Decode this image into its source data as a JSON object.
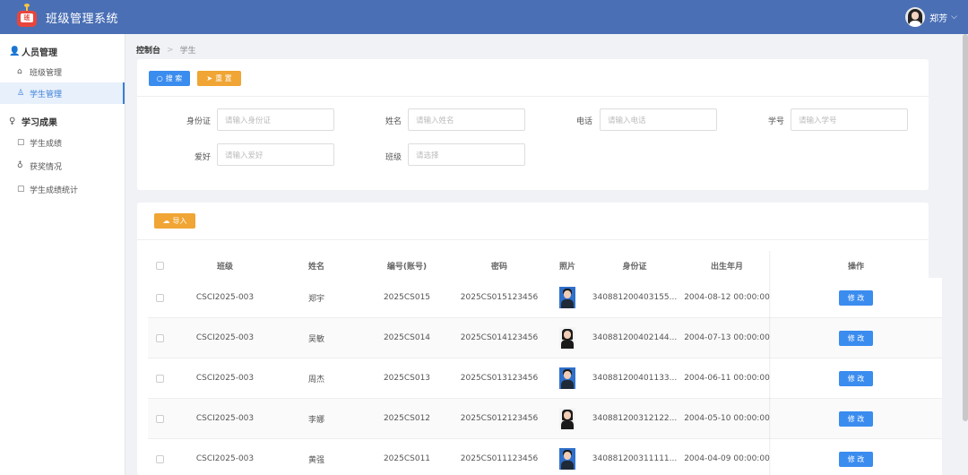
{
  "header": {
    "logo_glyph": "班",
    "title": "班级管理系统",
    "user_name": "郑芳"
  },
  "sidebar": {
    "groups": [
      {
        "label": "人员管理",
        "icon": "person-icon",
        "items": [
          {
            "label": "班级管理",
            "icon": "home-icon"
          },
          {
            "label": "学生管理",
            "icon": "user-icon",
            "active": true
          }
        ]
      },
      {
        "label": "学习成果",
        "icon": "trophy-icon",
        "items": [
          {
            "label": "学生成绩",
            "icon": "document-icon"
          },
          {
            "label": "获奖情况",
            "icon": "medal-icon"
          },
          {
            "label": "学生成绩统计",
            "icon": "document-icon"
          }
        ]
      }
    ]
  },
  "breadcrumb": {
    "home": "控制台",
    "current": "学生"
  },
  "search": {
    "search_button": "搜 索",
    "reset_button": "重 置",
    "fields": [
      {
        "label": "身份证",
        "placeholder": "请输入身份证"
      },
      {
        "label": "姓名",
        "placeholder": "请输入姓名"
      },
      {
        "label": "电话",
        "placeholder": "请输入电话"
      },
      {
        "label": "学号",
        "placeholder": "请输入学号"
      },
      {
        "label": "爱好",
        "placeholder": "请输入爱好"
      },
      {
        "label": "班级",
        "placeholder": "请选择"
      }
    ]
  },
  "table": {
    "import_button": "导入",
    "columns": [
      "班级",
      "姓名",
      "编号(账号)",
      "密码",
      "照片",
      "身份证",
      "出生年月",
      "操作"
    ],
    "edit_label": "修 改",
    "rows": [
      {
        "class": "CSCI2025-003",
        "name": "郑宇",
        "code": "2025CS015",
        "password": "2025CS015123456",
        "id_card": "340881200403155...",
        "birth": "2004-08-12 00:00:00",
        "photo": "male"
      },
      {
        "class": "CSCI2025-003",
        "name": "吴敏",
        "code": "2025CS014",
        "password": "2025CS014123456",
        "id_card": "340881200402144...",
        "birth": "2004-07-13 00:00:00",
        "photo": "female"
      },
      {
        "class": "CSCI2025-003",
        "name": "周杰",
        "code": "2025CS013",
        "password": "2025CS013123456",
        "id_card": "340881200401133...",
        "birth": "2004-06-11 00:00:00",
        "photo": "male"
      },
      {
        "class": "CSCI2025-003",
        "name": "李娜",
        "code": "2025CS012",
        "password": "2025CS012123456",
        "id_card": "340881200312122...",
        "birth": "2004-05-10 00:00:00",
        "photo": "female"
      },
      {
        "class": "CSCI2025-003",
        "name": "黄强",
        "code": "2025CS011",
        "password": "2025CS011123456",
        "id_card": "340881200311111...",
        "birth": "2004-04-09 00:00:00",
        "photo": "male"
      }
    ]
  }
}
